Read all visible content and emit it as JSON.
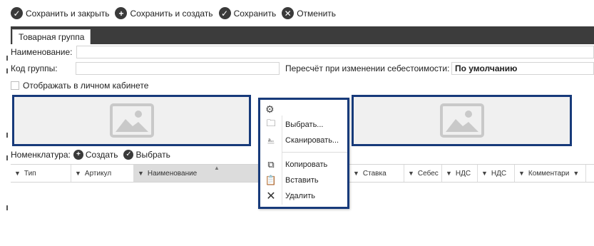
{
  "toolbar": {
    "save_close": "Сохранить и закрыть",
    "save_create": "Сохранить и создать",
    "save": "Сохранить",
    "cancel": "Отменить"
  },
  "tab": {
    "label": "Товарная группа"
  },
  "form": {
    "name_label": "Наименование:",
    "group_code_label": "Код группы:",
    "recalc_label": "Пересчёт при изменении себестоимости:",
    "recalc_value": "По умолчанию",
    "show_cabinet_label": "Отображать в личном кабинете"
  },
  "nomenclature": {
    "label": "Номенклатура:",
    "create": "Создать",
    "select": "Выбрать"
  },
  "grid": {
    "columns": [
      "Тип",
      "Артикул",
      "Наименование",
      "Ставка",
      "Себес",
      "НДС",
      "НДС",
      "Комментари"
    ]
  },
  "context_menu": {
    "items": [
      "Выбрать...",
      "Сканировать...",
      "Копировать",
      "Вставить",
      "Удалить"
    ]
  },
  "icons": {
    "check": "check-circle-icon",
    "plus": "plus-circle-icon",
    "cancel": "x-circle-icon",
    "gear": "gear-icon",
    "folder": "folder-icon",
    "scan": "scan-icon",
    "copy": "copy-icon",
    "paste": "paste-icon",
    "delete": "delete-icon",
    "filter": "filter-icon",
    "image": "image-placeholder-icon"
  },
  "colors": {
    "highlight_border": "#173a7a",
    "tabbar": "#3c3c3c",
    "icon_dark": "#3a3a3a"
  }
}
